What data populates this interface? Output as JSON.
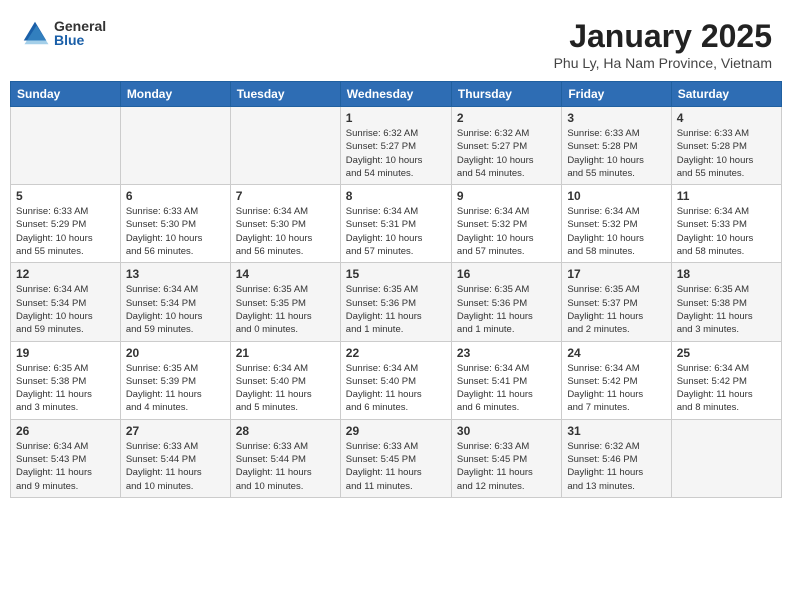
{
  "logo": {
    "general": "General",
    "blue": "Blue"
  },
  "title": "January 2025",
  "subtitle": "Phu Ly, Ha Nam Province, Vietnam",
  "days_of_week": [
    "Sunday",
    "Monday",
    "Tuesday",
    "Wednesday",
    "Thursday",
    "Friday",
    "Saturday"
  ],
  "weeks": [
    [
      {
        "day": "",
        "info": ""
      },
      {
        "day": "",
        "info": ""
      },
      {
        "day": "",
        "info": ""
      },
      {
        "day": "1",
        "info": "Sunrise: 6:32 AM\nSunset: 5:27 PM\nDaylight: 10 hours\nand 54 minutes."
      },
      {
        "day": "2",
        "info": "Sunrise: 6:32 AM\nSunset: 5:27 PM\nDaylight: 10 hours\nand 54 minutes."
      },
      {
        "day": "3",
        "info": "Sunrise: 6:33 AM\nSunset: 5:28 PM\nDaylight: 10 hours\nand 55 minutes."
      },
      {
        "day": "4",
        "info": "Sunrise: 6:33 AM\nSunset: 5:28 PM\nDaylight: 10 hours\nand 55 minutes."
      }
    ],
    [
      {
        "day": "5",
        "info": "Sunrise: 6:33 AM\nSunset: 5:29 PM\nDaylight: 10 hours\nand 55 minutes."
      },
      {
        "day": "6",
        "info": "Sunrise: 6:33 AM\nSunset: 5:30 PM\nDaylight: 10 hours\nand 56 minutes."
      },
      {
        "day": "7",
        "info": "Sunrise: 6:34 AM\nSunset: 5:30 PM\nDaylight: 10 hours\nand 56 minutes."
      },
      {
        "day": "8",
        "info": "Sunrise: 6:34 AM\nSunset: 5:31 PM\nDaylight: 10 hours\nand 57 minutes."
      },
      {
        "day": "9",
        "info": "Sunrise: 6:34 AM\nSunset: 5:32 PM\nDaylight: 10 hours\nand 57 minutes."
      },
      {
        "day": "10",
        "info": "Sunrise: 6:34 AM\nSunset: 5:32 PM\nDaylight: 10 hours\nand 58 minutes."
      },
      {
        "day": "11",
        "info": "Sunrise: 6:34 AM\nSunset: 5:33 PM\nDaylight: 10 hours\nand 58 minutes."
      }
    ],
    [
      {
        "day": "12",
        "info": "Sunrise: 6:34 AM\nSunset: 5:34 PM\nDaylight: 10 hours\nand 59 minutes."
      },
      {
        "day": "13",
        "info": "Sunrise: 6:34 AM\nSunset: 5:34 PM\nDaylight: 10 hours\nand 59 minutes."
      },
      {
        "day": "14",
        "info": "Sunrise: 6:35 AM\nSunset: 5:35 PM\nDaylight: 11 hours\nand 0 minutes."
      },
      {
        "day": "15",
        "info": "Sunrise: 6:35 AM\nSunset: 5:36 PM\nDaylight: 11 hours\nand 1 minute."
      },
      {
        "day": "16",
        "info": "Sunrise: 6:35 AM\nSunset: 5:36 PM\nDaylight: 11 hours\nand 1 minute."
      },
      {
        "day": "17",
        "info": "Sunrise: 6:35 AM\nSunset: 5:37 PM\nDaylight: 11 hours\nand 2 minutes."
      },
      {
        "day": "18",
        "info": "Sunrise: 6:35 AM\nSunset: 5:38 PM\nDaylight: 11 hours\nand 3 minutes."
      }
    ],
    [
      {
        "day": "19",
        "info": "Sunrise: 6:35 AM\nSunset: 5:38 PM\nDaylight: 11 hours\nand 3 minutes."
      },
      {
        "day": "20",
        "info": "Sunrise: 6:35 AM\nSunset: 5:39 PM\nDaylight: 11 hours\nand 4 minutes."
      },
      {
        "day": "21",
        "info": "Sunrise: 6:34 AM\nSunset: 5:40 PM\nDaylight: 11 hours\nand 5 minutes."
      },
      {
        "day": "22",
        "info": "Sunrise: 6:34 AM\nSunset: 5:40 PM\nDaylight: 11 hours\nand 6 minutes."
      },
      {
        "day": "23",
        "info": "Sunrise: 6:34 AM\nSunset: 5:41 PM\nDaylight: 11 hours\nand 6 minutes."
      },
      {
        "day": "24",
        "info": "Sunrise: 6:34 AM\nSunset: 5:42 PM\nDaylight: 11 hours\nand 7 minutes."
      },
      {
        "day": "25",
        "info": "Sunrise: 6:34 AM\nSunset: 5:42 PM\nDaylight: 11 hours\nand 8 minutes."
      }
    ],
    [
      {
        "day": "26",
        "info": "Sunrise: 6:34 AM\nSunset: 5:43 PM\nDaylight: 11 hours\nand 9 minutes."
      },
      {
        "day": "27",
        "info": "Sunrise: 6:33 AM\nSunset: 5:44 PM\nDaylight: 11 hours\nand 10 minutes."
      },
      {
        "day": "28",
        "info": "Sunrise: 6:33 AM\nSunset: 5:44 PM\nDaylight: 11 hours\nand 10 minutes."
      },
      {
        "day": "29",
        "info": "Sunrise: 6:33 AM\nSunset: 5:45 PM\nDaylight: 11 hours\nand 11 minutes."
      },
      {
        "day": "30",
        "info": "Sunrise: 6:33 AM\nSunset: 5:45 PM\nDaylight: 11 hours\nand 12 minutes."
      },
      {
        "day": "31",
        "info": "Sunrise: 6:32 AM\nSunset: 5:46 PM\nDaylight: 11 hours\nand 13 minutes."
      },
      {
        "day": "",
        "info": ""
      }
    ]
  ]
}
